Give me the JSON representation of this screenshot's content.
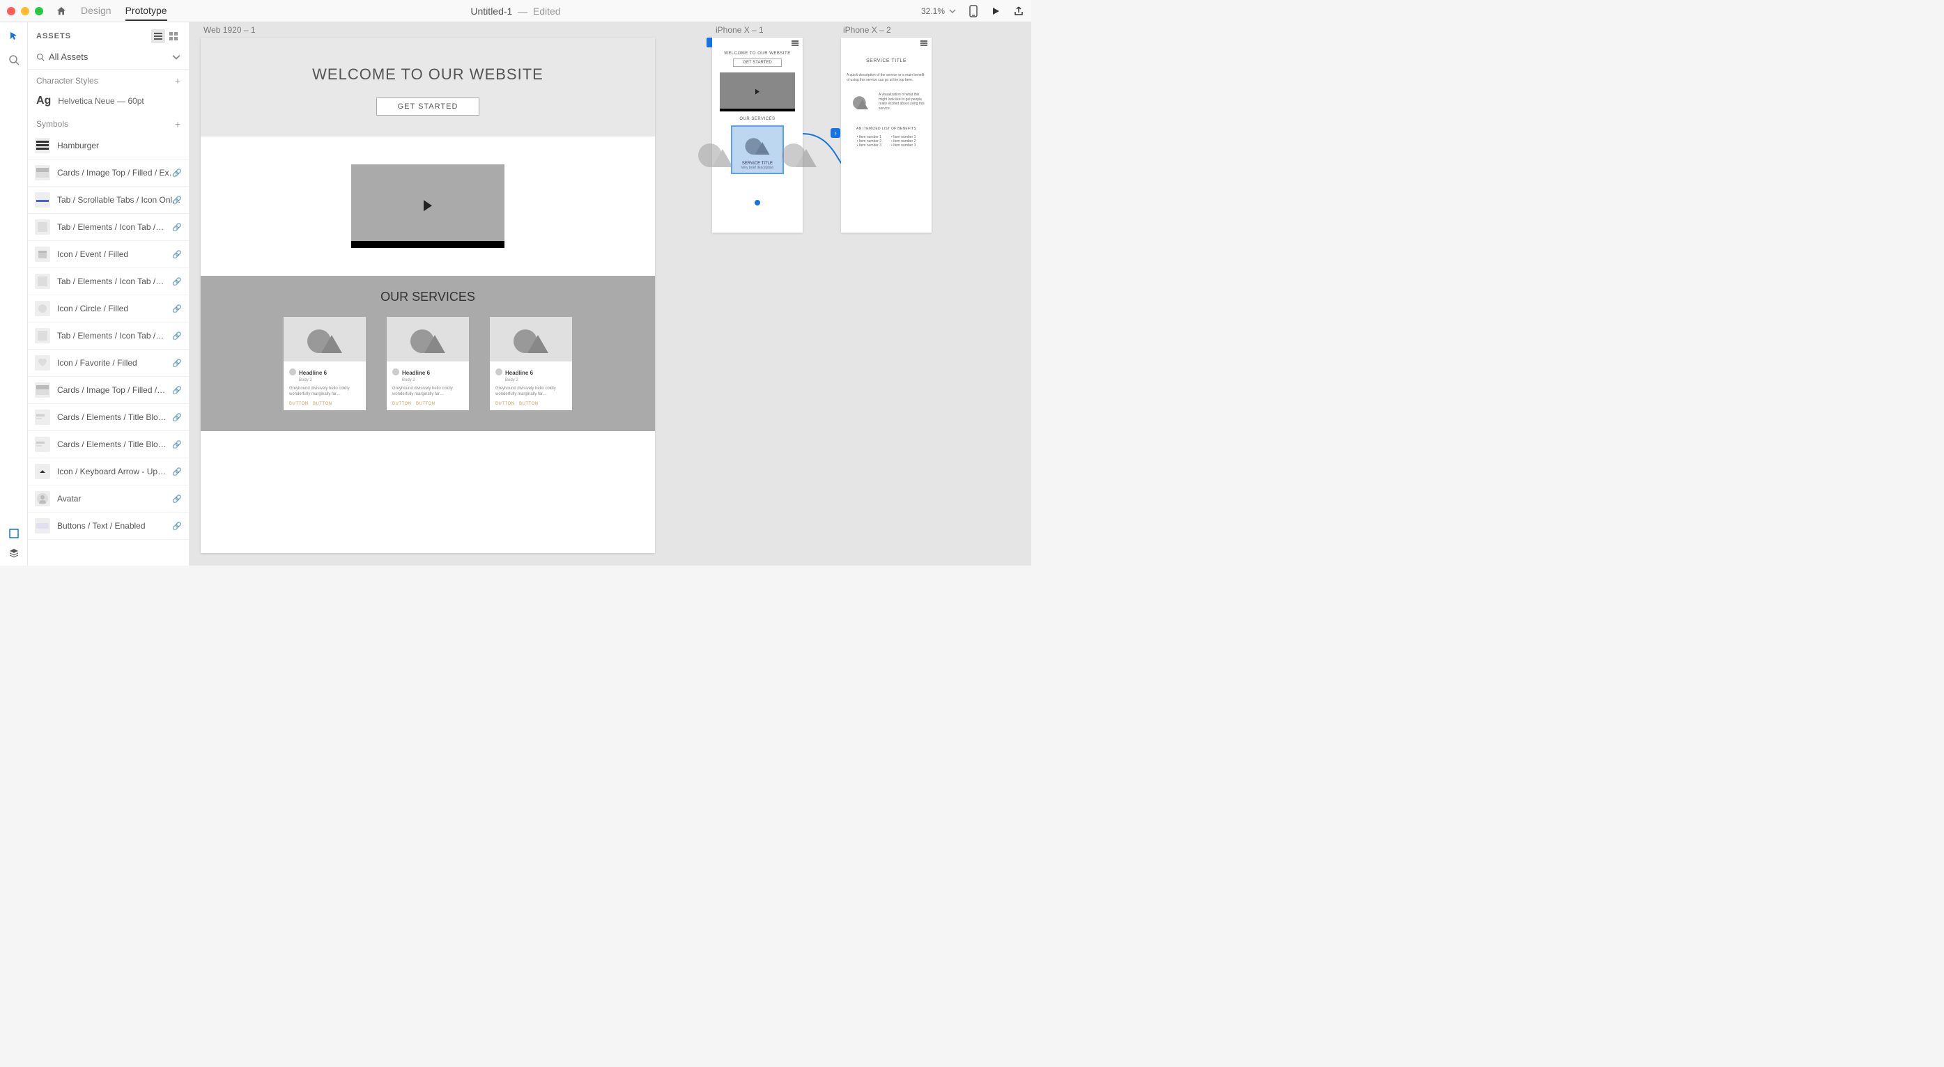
{
  "titlebar": {
    "tab_design": "Design",
    "tab_prototype": "Prototype",
    "doc_name": "Untitled-1",
    "doc_status": "Edited",
    "zoom": "32.1%"
  },
  "assets": {
    "panel_title": "ASSETS",
    "search_label": "All Assets",
    "char_styles_label": "Character Styles",
    "charstyle_sample": "Ag",
    "charstyle_name": "Helvetica Neue — 60pt",
    "symbols_label": "Symbols",
    "symbols": [
      {
        "label": "Hamburger",
        "icon": "hamburger"
      },
      {
        "label": "Cards / Image Top / Filled / Exp…",
        "icon": "card"
      },
      {
        "label": "Tab / Scrollable Tabs / Icon Onl…",
        "icon": "tab-line"
      },
      {
        "label": "Tab / Elements / Icon Tab /…",
        "icon": "tab-el"
      },
      {
        "label": "Icon / Event / Filled",
        "icon": "event"
      },
      {
        "label": "Tab / Elements / Icon Tab /…",
        "icon": "tab-el"
      },
      {
        "label": "Icon / Circle / Filled",
        "icon": "circle"
      },
      {
        "label": "Tab / Elements / Icon Tab /…",
        "icon": "tab-el"
      },
      {
        "label": "Icon / Favorite / Filled",
        "icon": "heart"
      },
      {
        "label": "Cards / Image Top / Filled /…",
        "icon": "card"
      },
      {
        "label": "Cards / Elements / Title Blo…",
        "icon": "title"
      },
      {
        "label": "Cards / Elements / Title Blo…",
        "icon": "title"
      },
      {
        "label": "Icon / Keyboard Arrow - Up…",
        "icon": "arrow-up"
      },
      {
        "label": "Avatar",
        "icon": "avatar"
      },
      {
        "label": "Buttons / Text / Enabled",
        "icon": "button"
      }
    ]
  },
  "canvas": {
    "web_label": "Web 1920 – 1",
    "iphone1_label": "iPhone X – 1",
    "iphone2_label": "iPhone X – 2",
    "web": {
      "hero_title": "WELCOME TO OUR WEBSITE",
      "cta": "GET STARTED",
      "services_title": "OUR SERVICES",
      "card_headline": "Headline 6",
      "card_sub": "Body 2",
      "card_desc": "Greyhound divisively hello coldly wonderfully marginally far…",
      "card_button": "BUTTON"
    },
    "iphone1": {
      "hero": "WELCOME TO OUR WEBSITE",
      "cta": "GET STARTED",
      "services": "OUR SERVICES",
      "card_title": "SERVICE TITLE",
      "card_desc": "Very brief description"
    },
    "iphone2": {
      "title": "SERVICE TITLE",
      "desc1": "A quick description of the service or a main benefit of using this service can go at the top here.",
      "desc2": "A visualization of what this might look like to get people really excited about using this service.",
      "benefits_title": "AN ITEMIZED LIST OF BENEFITS",
      "benefits_left": [
        "Item number 1",
        "Item number 2",
        "Item number 3"
      ],
      "benefits_right": [
        "Item number 1",
        "Item number 2",
        "Item number 3"
      ]
    }
  }
}
